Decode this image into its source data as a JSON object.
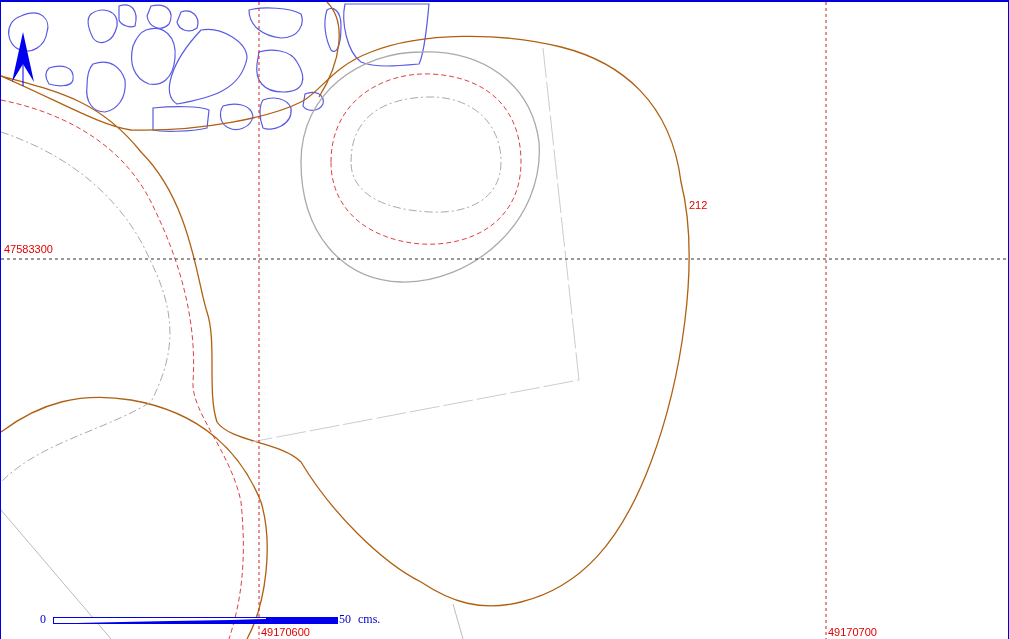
{
  "map": {
    "grid_labels": [
      {
        "kind": "horizontal",
        "text": "47583300"
      },
      {
        "kind": "vertical",
        "text": "49170600"
      },
      {
        "kind": "vertical",
        "text": "49170700"
      }
    ],
    "contour_labels": [
      {
        "text": "212"
      }
    ],
    "scale_bar": {
      "start": "0",
      "end": "50",
      "unit": "cms."
    }
  }
}
